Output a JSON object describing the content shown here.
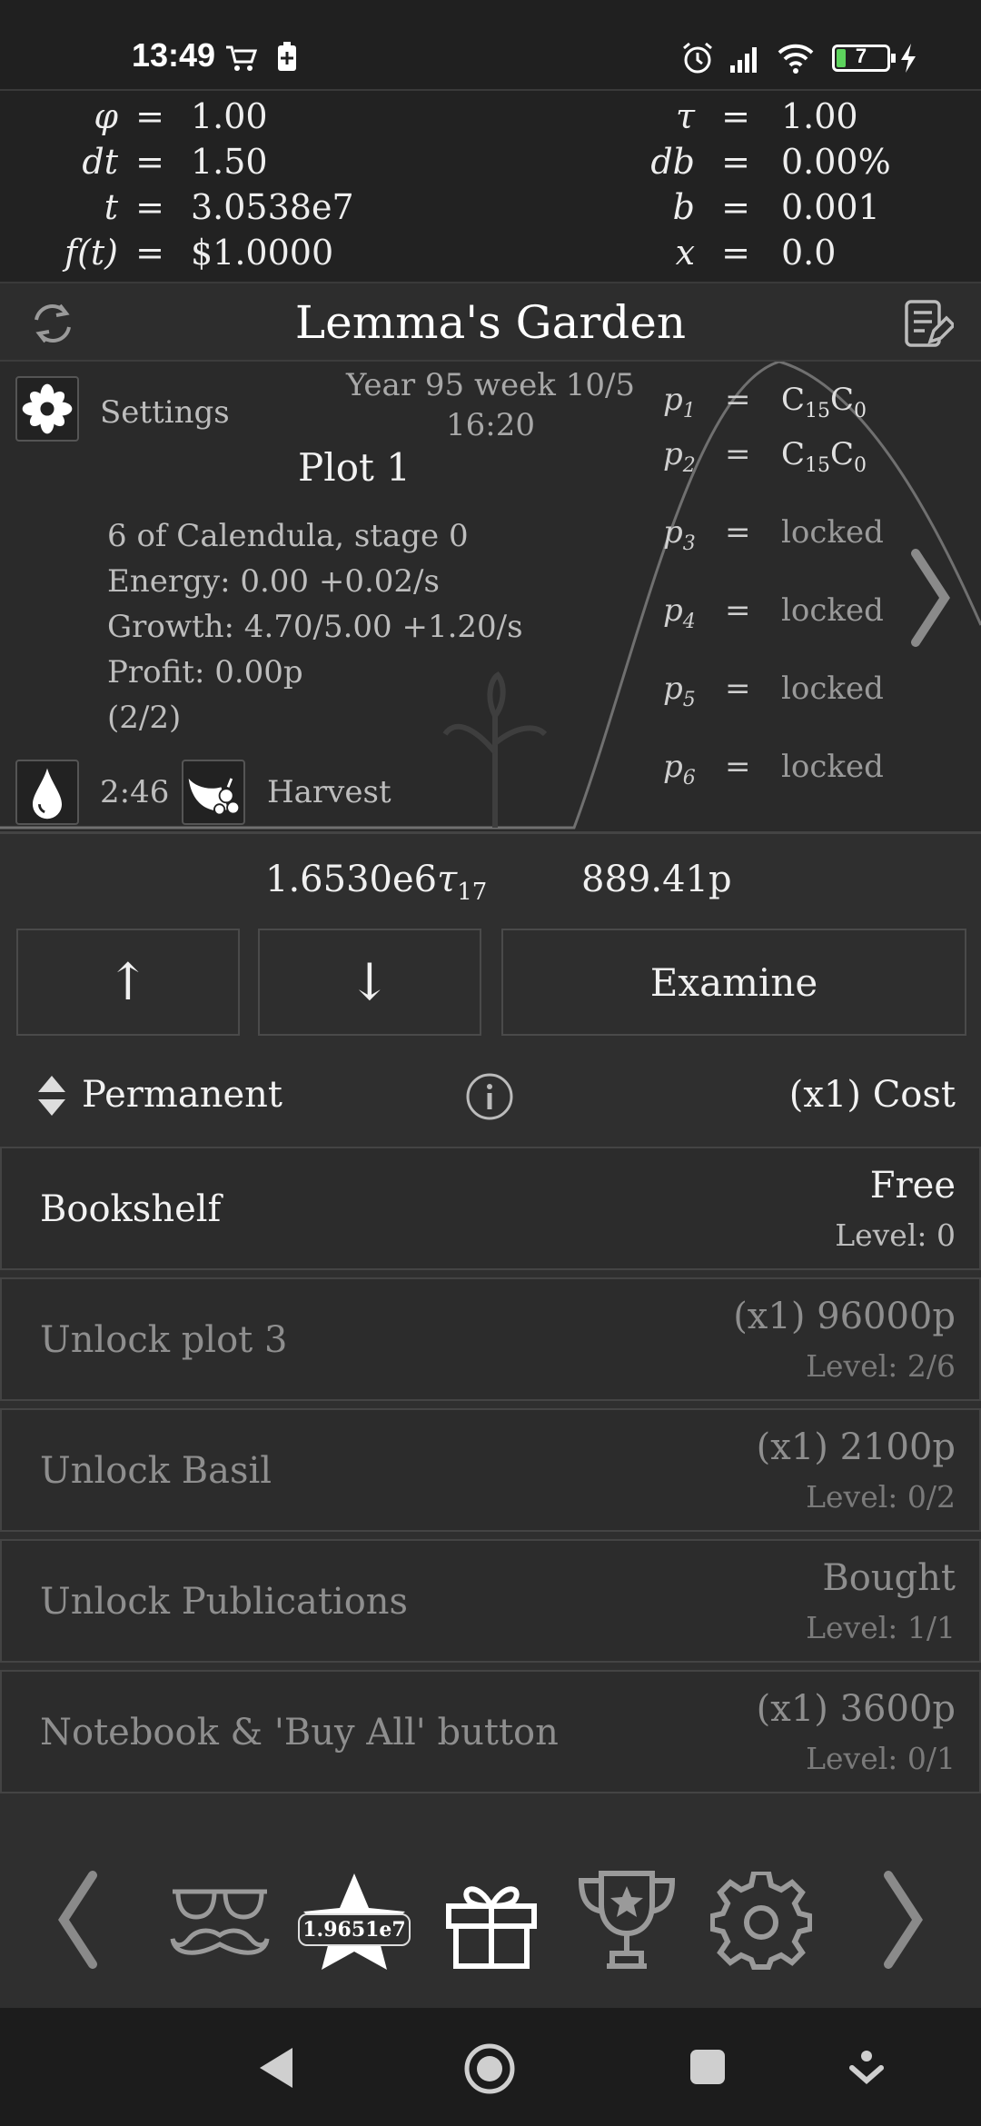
{
  "status_bar": {
    "time": "13:49",
    "battery": "7",
    "icons": [
      "cart-icon",
      "battery-saver-icon",
      "alarm-icon",
      "signal-icon",
      "wifi-icon",
      "battery-icon",
      "charging-icon"
    ]
  },
  "variables": {
    "left": [
      {
        "symbol": "φ",
        "eq": "=",
        "value": "1.00"
      },
      {
        "symbol": "dt",
        "eq": "=",
        "value": "1.50"
      },
      {
        "symbol": "t",
        "eq": "=",
        "value": "3.0538e7"
      },
      {
        "symbol": "f(t)",
        "eq": "=",
        "value": "$1.0000"
      }
    ],
    "right": [
      {
        "symbol": "τ",
        "eq": "=",
        "value": "1.00"
      },
      {
        "symbol": "db",
        "eq": "=",
        "value": "0.00%"
      },
      {
        "symbol": "b",
        "eq": "=",
        "value": "0.001"
      },
      {
        "symbol": "x",
        "eq": "=",
        "value": "0.0"
      }
    ]
  },
  "title": "Lemma's Garden",
  "garden": {
    "settings_label": "Settings",
    "date": "Year 95 week 10/5",
    "clock": "16:20",
    "plot_title": "Plot 1",
    "details": [
      "6 of Calendula, stage 0",
      "Energy: 0.00 +0.02/s",
      "Growth: 4.70/5.00 +1.20/s",
      "Profit: 0.00p",
      "(2/2)"
    ],
    "water_timer": "2:46",
    "harvest_label": "Harvest",
    "profits": [
      {
        "symbol": "p",
        "sub": "1",
        "eq": "=",
        "value": "C",
        "v_sub1": "15",
        "v_mid": "C",
        "v_sub2": "0"
      },
      {
        "symbol": "p",
        "sub": "2",
        "eq": "=",
        "value": "C",
        "v_sub1": "15",
        "v_mid": "C",
        "v_sub2": "0"
      },
      {
        "symbol": "p",
        "sub": "3",
        "eq": "=",
        "value": "locked"
      },
      {
        "symbol": "p",
        "sub": "4",
        "eq": "=",
        "value": "locked"
      },
      {
        "symbol": "p",
        "sub": "5",
        "eq": "=",
        "value": "locked"
      },
      {
        "symbol": "p",
        "sub": "6",
        "eq": "=",
        "value": "locked"
      }
    ]
  },
  "currency": {
    "tau_value": "1.6530e6",
    "tau_symbol": "τ",
    "tau_sub": "17",
    "p_value": "889.41p"
  },
  "buttons": {
    "up": "↑",
    "down": "↓",
    "examine": "Examine"
  },
  "section": {
    "label": "Permanent",
    "cost_label": "(x1) Cost"
  },
  "upgrades": [
    {
      "name": "Bookshelf",
      "cost": "Free",
      "level": "Level: 0",
      "style": "bright"
    },
    {
      "name": "Unlock plot 3",
      "cost": "(x1) 96000p",
      "level": "Level: 2/6",
      "style": "dim"
    },
    {
      "name": "Unlock Basil",
      "cost": "(x1) 2100p",
      "level": "Level: 0/2",
      "style": "dim"
    },
    {
      "name": "Unlock Publications",
      "cost": "Bought",
      "level": "Level: 1/1",
      "style": "dim"
    },
    {
      "name": "Notebook & 'Buy All' button",
      "cost": "(x1) 3600p",
      "level": "Level: 0/1",
      "style": "dim"
    }
  ],
  "bottom_nav": {
    "star_badge": "1.9651e7"
  },
  "colors": {
    "background": "#2f2f2f",
    "panel": "#222222",
    "text": "#e8e8e8",
    "dim_text": "#8e8e8e"
  }
}
